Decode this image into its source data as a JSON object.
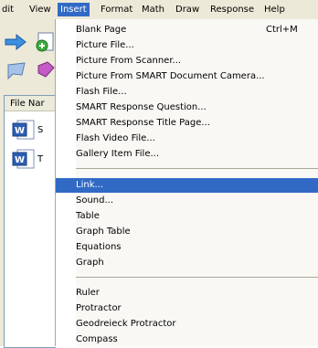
{
  "menubar": {
    "items": [
      "dit",
      "View",
      "Insert",
      "Format",
      "Math",
      "Draw",
      "Response",
      "Help"
    ]
  },
  "sidebar": {
    "column_header": "File Nar",
    "files": [
      {
        "letter": "S"
      },
      {
        "letter": "T"
      }
    ]
  },
  "insert_menu": {
    "group1": [
      {
        "label": "Blank Page",
        "shortcut": "Ctrl+M"
      },
      {
        "label": "Picture File..."
      },
      {
        "label": "Picture From Scanner..."
      },
      {
        "label": "Picture From SMART Document Camera..."
      },
      {
        "label": "Flash File..."
      },
      {
        "label": "SMART Response Question..."
      },
      {
        "label": "SMART Response Title Page..."
      },
      {
        "label": "Flash Video File..."
      },
      {
        "label": "Gallery Item File..."
      }
    ],
    "group2": [
      {
        "label": "Link..."
      },
      {
        "label": "Sound..."
      },
      {
        "label": "Table"
      },
      {
        "label": "Graph Table"
      },
      {
        "label": "Equations"
      },
      {
        "label": "Graph"
      }
    ],
    "group3": [
      {
        "label": "Ruler"
      },
      {
        "label": "Protractor"
      },
      {
        "label": "Geodreieck Protractor"
      },
      {
        "label": "Compass"
      }
    ],
    "highlighted": "Link..."
  },
  "colors": {
    "menu_highlight": "#316ac5",
    "chrome": "#ece9d8"
  }
}
